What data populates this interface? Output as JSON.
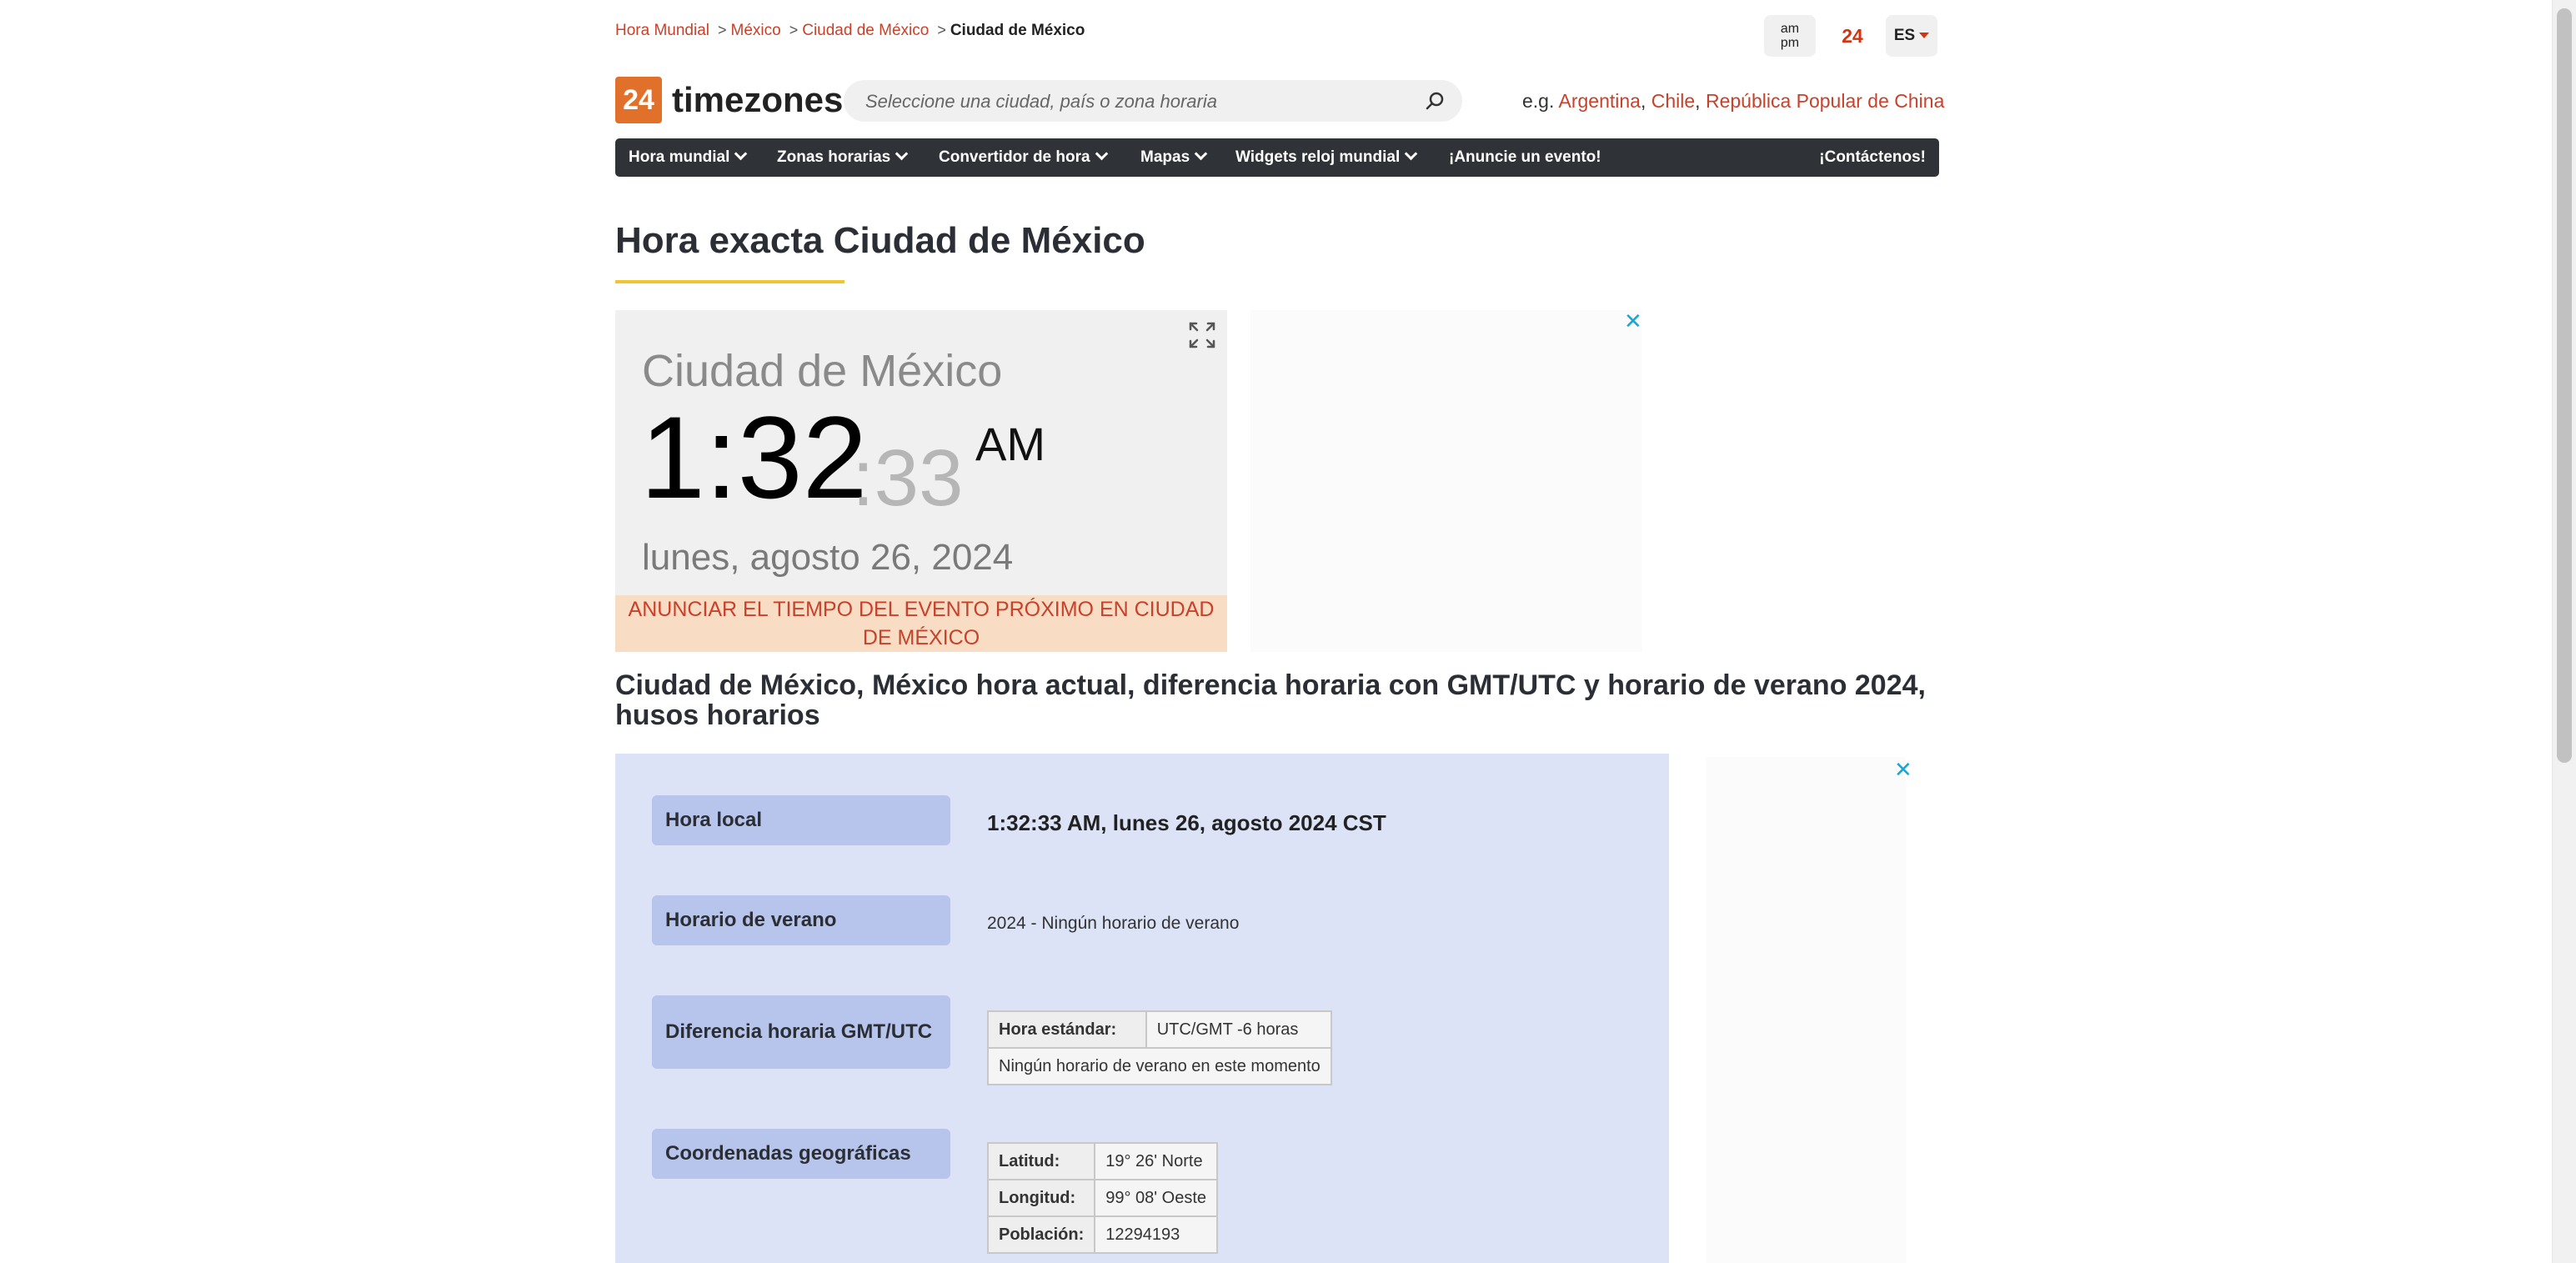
{
  "breadcrumb": {
    "items": [
      "Hora Mundial",
      "México",
      "Ciudad de México"
    ],
    "current": "Ciudad de México",
    "separator": ">"
  },
  "header": {
    "ampm_top": "am",
    "ampm_bottom": "pm",
    "format24": "24",
    "lang": "ES"
  },
  "logo": {
    "number": "24",
    "text": "timezones"
  },
  "search": {
    "placeholder": "Seleccione una ciudad, país o zona horaria",
    "examples_prefix": "e.g.",
    "examples": [
      "Argentina",
      "Chile",
      "República Popular de China"
    ]
  },
  "nav": {
    "items": [
      "Hora mundial",
      "Zonas horarias",
      "Convertidor de hora",
      "Mapas",
      "Widgets reloj mundial"
    ],
    "announce": "¡Anuncie un evento!",
    "contact": "¡Contáctenos!"
  },
  "page_title": "Hora exacta Ciudad de México",
  "clock": {
    "city": "Ciudad de México",
    "hours_minutes": "1:32",
    "seconds": ":33",
    "ampm": "AM",
    "date": "lunes, agosto 26, 2024",
    "announce_line1": "ANUNCIAR EL TIEMPO DEL EVENTO PRÓXIMO EN CIUDAD",
    "announce_line2": "DE MÉXICO"
  },
  "ads": {
    "close": "✕"
  },
  "section_heading": "Ciudad de México, México hora actual, diferencia horaria con GMT/UTC y horario de verano 2024, husos horarios",
  "info": {
    "local_time_label": "Hora local",
    "local_time_value": "1:32:33 AM, lunes 26, agosto 2024 CST",
    "dst_label": "Horario de verano",
    "dst_value": "2024 - Ningún horario de verano",
    "offset_label": "Diferencia horaria GMT/UTC",
    "offset_std_key": "Hora estándar:",
    "offset_std_value": "UTC/GMT -6 horas",
    "offset_note": "Ningún horario de verano en este momento",
    "coords_label": "Coordenadas geográficas",
    "lat_key": "Latitud:",
    "lat_value": "19° 26' Norte",
    "lon_key": "Longitud:",
    "lon_value": "99° 08' Oeste",
    "pop_key": "Población:",
    "pop_value": "12294193"
  },
  "colors": {
    "accent": "#c8412b",
    "logo_orange": "#e1702a",
    "nav_bg": "#2f3237",
    "panel_bg": "#dde3f7",
    "label_bg": "#b7c4eb",
    "announce_bg": "#f8dcc3"
  },
  "icons": [
    "search-icon",
    "expand-icon",
    "chevron-down-icon",
    "close-icon"
  ]
}
